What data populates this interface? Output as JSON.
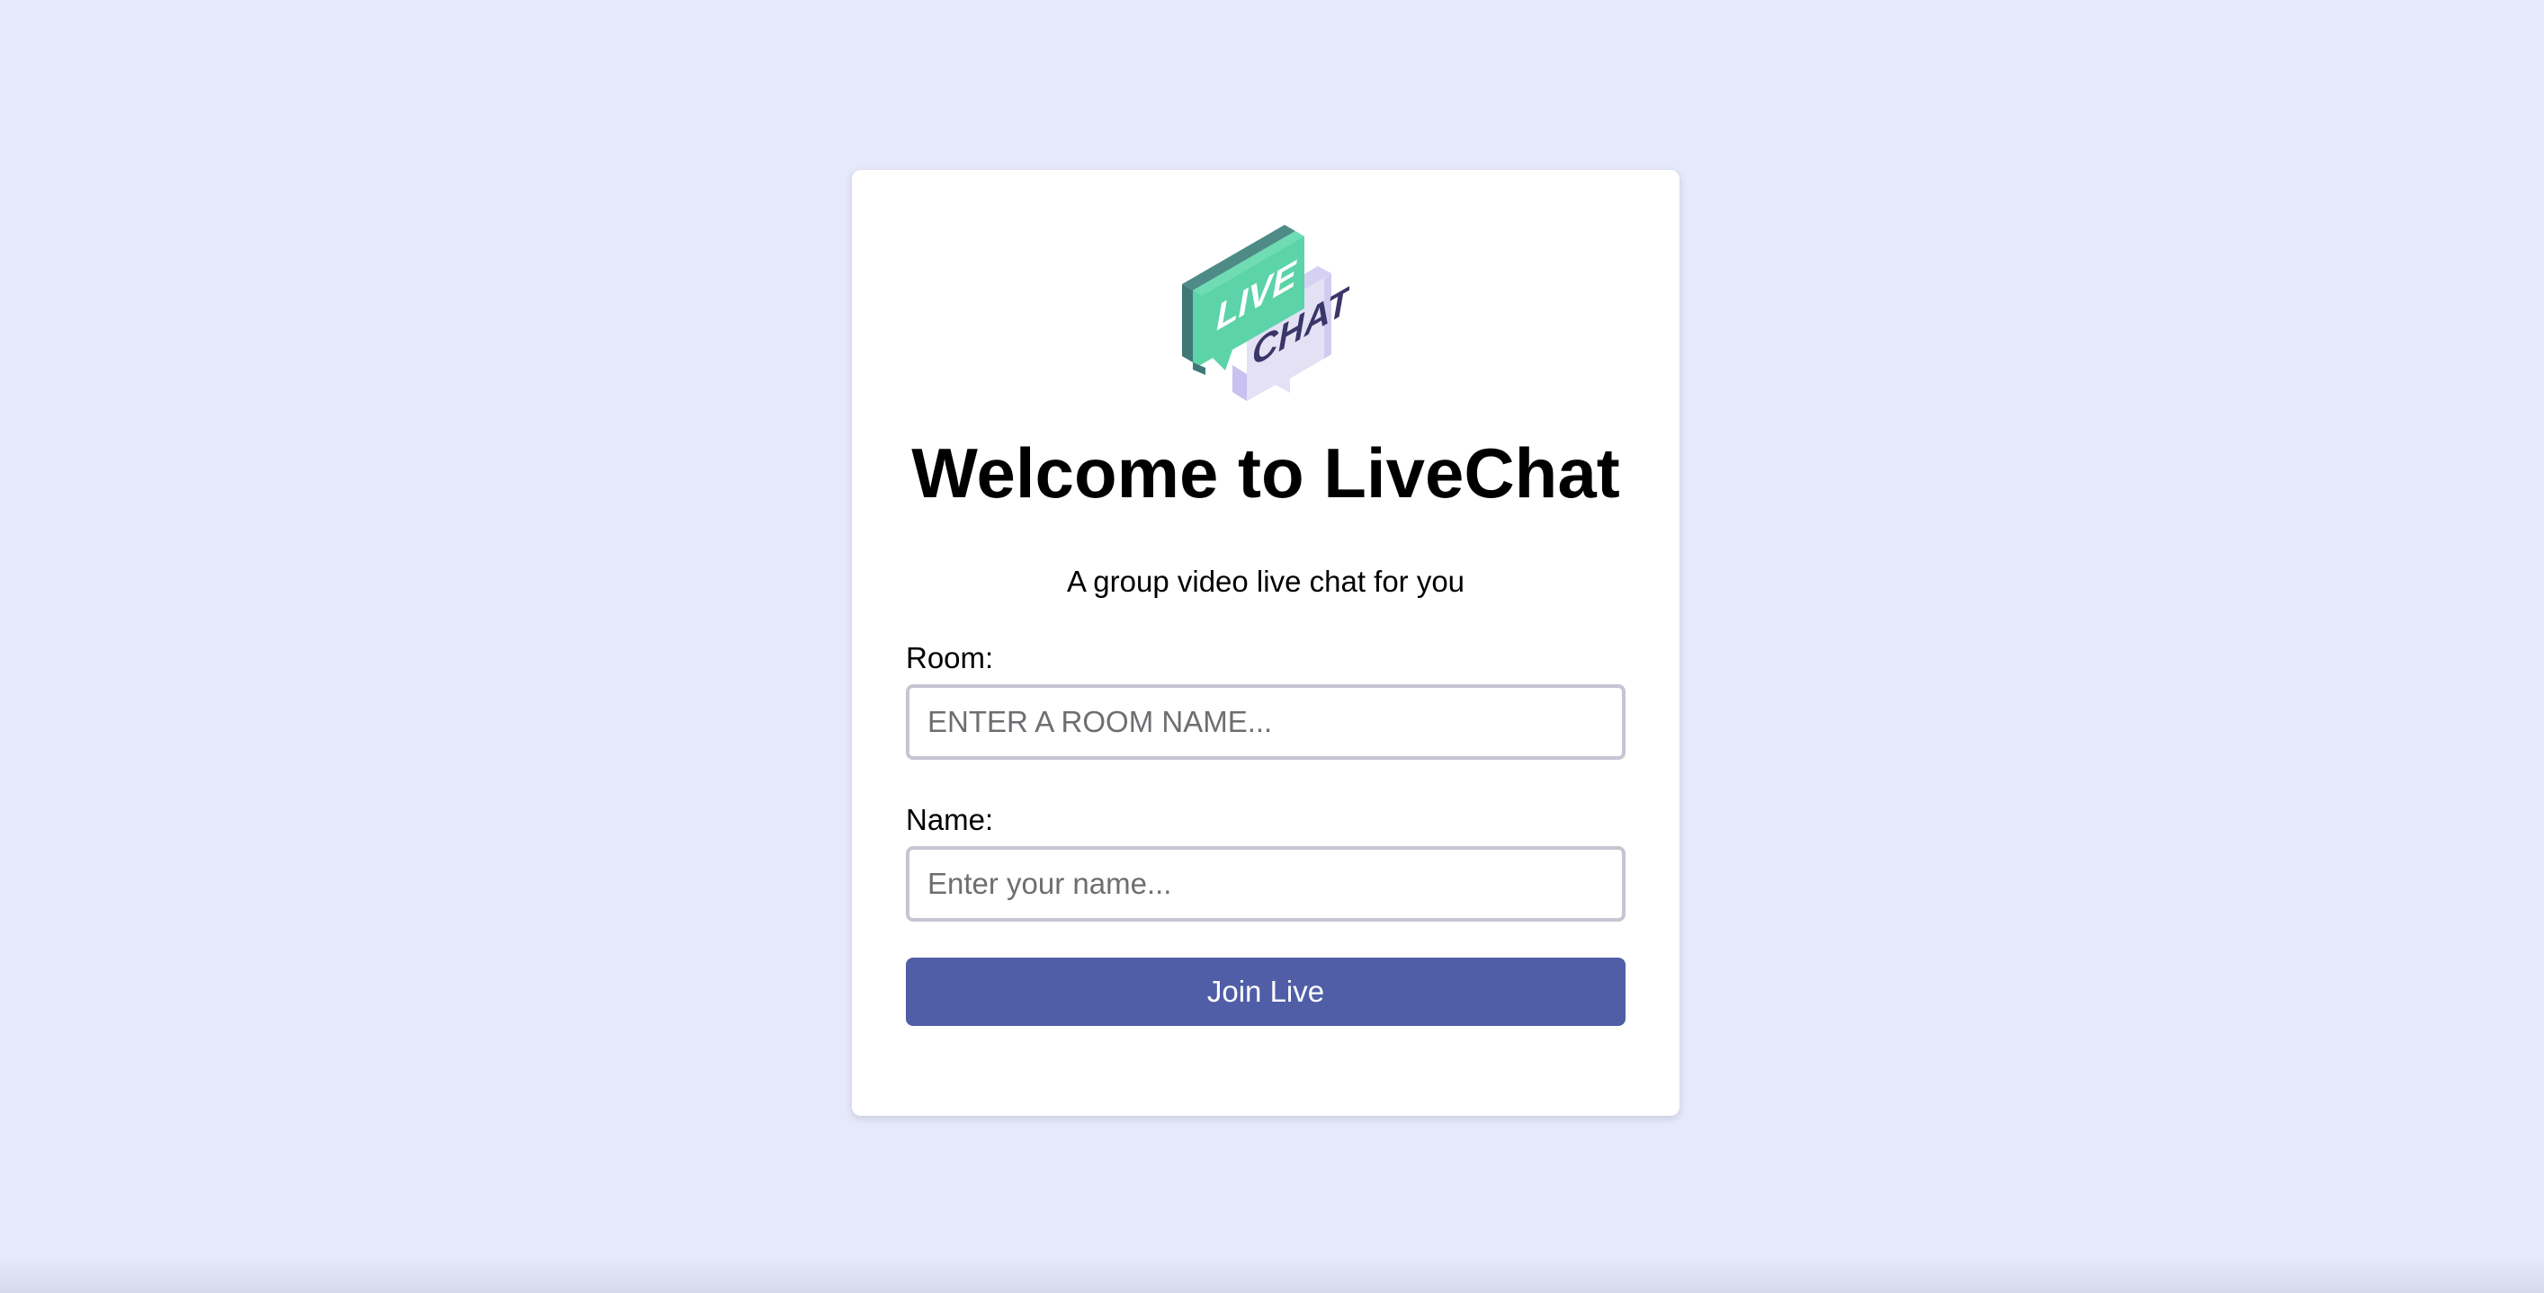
{
  "colors": {
    "background": "#e6e9f9",
    "card": "#ffffff",
    "accent": "#505ea8",
    "logo_green": "#5cd3a8",
    "logo_purple": "#e4e1f5"
  },
  "logo": {
    "icon": "live-chat-logo-icon",
    "word_top": "LIVE",
    "word_bottom": "CHAT"
  },
  "header": {
    "title": "Welcome to LiveChat",
    "subtitle": "A group video live chat for you"
  },
  "form": {
    "room": {
      "label": "Room:",
      "value": "",
      "placeholder": "ENTER A ROOM NAME..."
    },
    "name": {
      "label": "Name:",
      "value": "",
      "placeholder": "Enter your name..."
    },
    "submit_label": "Join Live"
  }
}
